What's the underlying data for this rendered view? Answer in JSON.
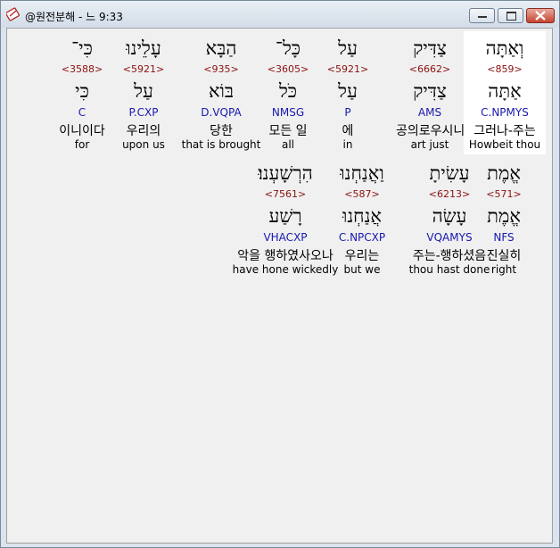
{
  "window": {
    "title": "@원전분해 - 느 9:33",
    "app_icon": "bible-app-icon",
    "controls": [
      "minimize-icon",
      "maximize-icon",
      "close-icon"
    ]
  },
  "rows": [
    {
      "words": [
        {
          "hebrew": "וְאַתָּה",
          "strong": "<859>",
          "lemma": "אַתָּה",
          "parse": "C.NPMYS",
          "korean": "그러나-주는",
          "english": "Howbeit thou",
          "selected": true
        },
        {
          "hebrew": "צַדִּיק",
          "strong": "<6662>",
          "lemma": "צַדִּיק",
          "parse": "AMS",
          "korean": "공의로우시니",
          "english": "art just",
          "selected": false
        },
        {
          "hebrew": "עַל",
          "strong": "<5921>",
          "lemma": "עַל",
          "parse": "P",
          "korean": "에",
          "english": "in",
          "selected": false
        },
        {
          "hebrew": "כָּל־",
          "strong": "<3605>",
          "lemma": "כֹּל",
          "parse": "NMSG",
          "korean": "모든 일",
          "english": "all",
          "selected": false
        },
        {
          "hebrew": "הַבָּא",
          "strong": "<935>",
          "lemma": "בּוֹא",
          "parse": "D.VQPA",
          "korean": "당한",
          "english": "that is brought",
          "selected": false
        },
        {
          "hebrew": "עָלֵינוּ",
          "strong": "<5921>",
          "lemma": "עַל",
          "parse": "P.CXP",
          "korean": "우리의",
          "english": "upon us",
          "selected": false
        },
        {
          "hebrew": "כִּי־",
          "strong": "<3588>",
          "lemma": "כִּי",
          "parse": "C",
          "korean": "이니이다",
          "english": "for",
          "selected": false
        }
      ]
    },
    {
      "words": [
        {
          "hebrew": "אֱמֶת",
          "strong": "<571>",
          "lemma": "אֱמֶת",
          "parse": "NFS",
          "korean": "진실히",
          "english": "right",
          "selected": false
        },
        {
          "hebrew": "עָשִׂיתָ",
          "strong": "<6213>",
          "lemma": "עָשָׂה",
          "parse": "VQAMYS",
          "korean": "주는-행하셨음",
          "english": "thou hast done",
          "selected": false
        },
        {
          "hebrew": "וַאֲנַחְנוּ",
          "strong": "<587>",
          "lemma": "אֲנַחְנוּ",
          "parse": "C.NPCXP",
          "korean": "우리는",
          "english": "but we",
          "selected": false
        },
        {
          "hebrew": "הִרְשָׁעְנוּ׃",
          "strong": "<7561>",
          "lemma": "רָשַׁע",
          "parse": "VHACXP",
          "korean": "악을 행하였사오나",
          "english": "have hone wickedly",
          "selected": false
        }
      ]
    }
  ]
}
